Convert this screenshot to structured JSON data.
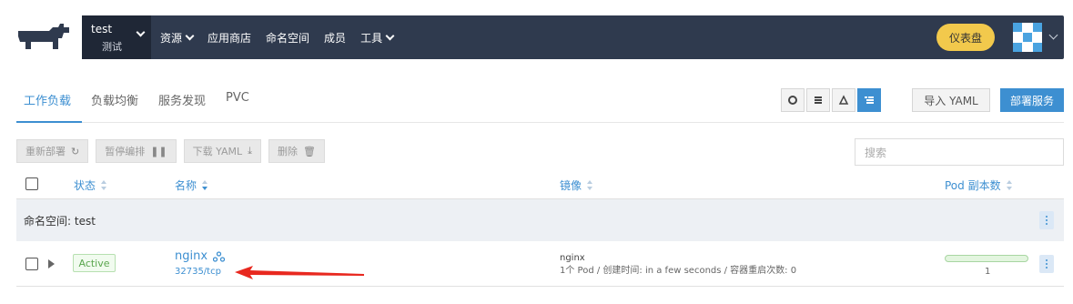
{
  "topbar": {
    "cluster_name": "test",
    "project_name": "测试",
    "nav": [
      "资源",
      "应用商店",
      "命名空间",
      "成员",
      "工具"
    ],
    "nav_dropdown": [
      true,
      false,
      false,
      false,
      true
    ],
    "dashboard_button": "仪表盘"
  },
  "tabs": {
    "items": [
      "工作负载",
      "负载均衡",
      "服务发现",
      "PVC"
    ],
    "active": "工作负载"
  },
  "toolbar": {
    "view_icons": [
      "circle-icon",
      "list-icon",
      "triangle-icon",
      "tree-icon"
    ],
    "import_label": "导入 YAML",
    "deploy_label": "部署服务"
  },
  "actions": {
    "redeploy": "重新部署",
    "pause": "暂停编排",
    "download": "下载 YAML",
    "delete": "删除"
  },
  "search": {
    "placeholder": "搜索"
  },
  "table": {
    "headers": {
      "state": "状态",
      "name": "名称",
      "image": "镜像",
      "pods": "Pod 副本数"
    },
    "group_label": "命名空间: test",
    "rows": [
      {
        "state": "Active",
        "name": "nginx",
        "port": "32735/tcp",
        "image": "nginx",
        "image_detail": "1个 Pod / 创建时间: in a few seconds / 容器重启次数: 0",
        "pod_count": "1",
        "pod_ready_fraction": 1.0
      }
    ]
  },
  "colors": {
    "topbar_bg": "#2f3a4e",
    "accent": "#3d8fd1",
    "dashboard_btn": "#f2c94c",
    "active_badge": "#5aa64e",
    "annotation_arrow": "#e8281f"
  }
}
